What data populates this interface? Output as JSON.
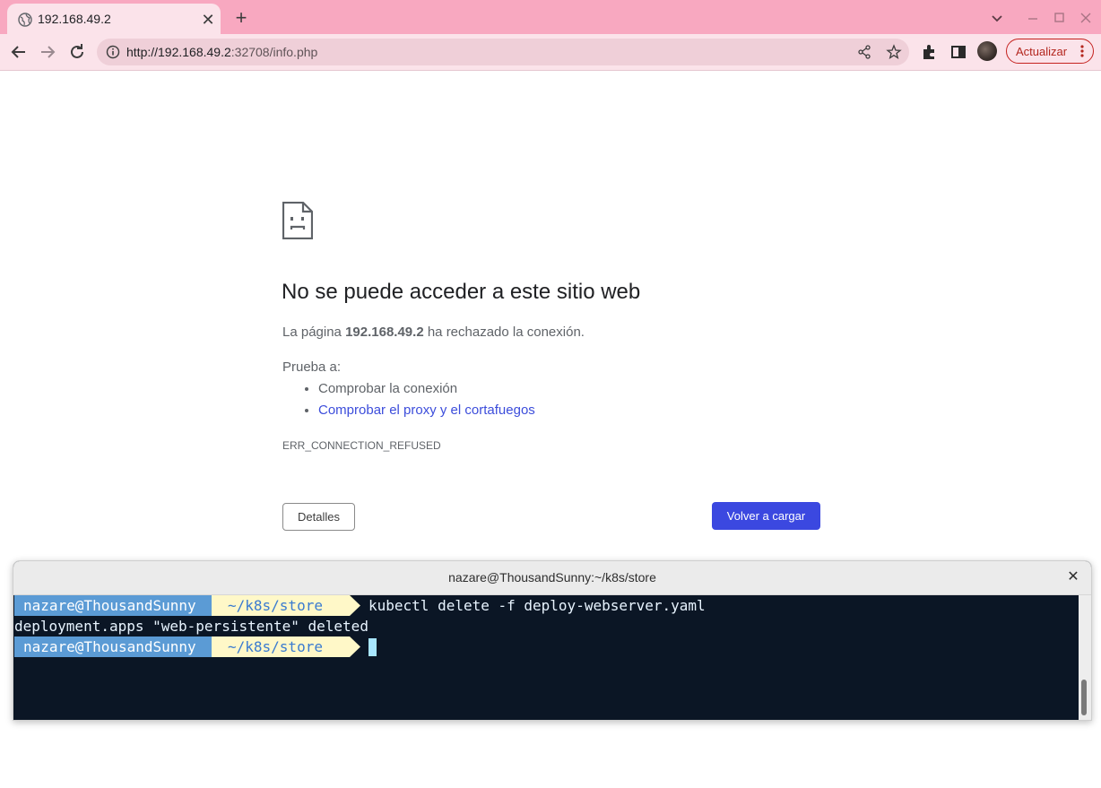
{
  "browser": {
    "tab": {
      "title": "192.168.49.2"
    },
    "omnibox": {
      "url_host": "http://192.168.49.2",
      "url_rest": ":32708/info.php"
    },
    "update_button": "Actualizar"
  },
  "error_page": {
    "title": "No se puede acceder a este sitio web",
    "desc_prefix": "La página ",
    "desc_host": "192.168.49.2",
    "desc_suffix": " ha rechazado la conexión.",
    "try_label": "Prueba a:",
    "suggestions": [
      "Comprobar la conexión",
      "Comprobar el proxy y el cortafuegos"
    ],
    "error_code": "ERR_CONNECTION_REFUSED",
    "details_button": "Detalles",
    "reload_button": "Volver a cargar"
  },
  "terminal": {
    "title": "nazare@ThousandSunny:~/k8s/store",
    "prompt_user": "nazare@ThousandSunny",
    "prompt_path": "~/k8s/store",
    "command": "kubectl delete -f deploy-webserver.yaml",
    "output": "deployment.apps \"web-persistente\" deleted"
  },
  "colors": {
    "tabstrip": "#f8a8c0",
    "toolbar": "#fbe3ea",
    "reload_button": "#3b48e0",
    "link": "#3c4ddb",
    "prompt_user_bg": "#5b9bd5",
    "prompt_path_bg": "#fff8c8",
    "terminal_bg": "#0b1625"
  }
}
